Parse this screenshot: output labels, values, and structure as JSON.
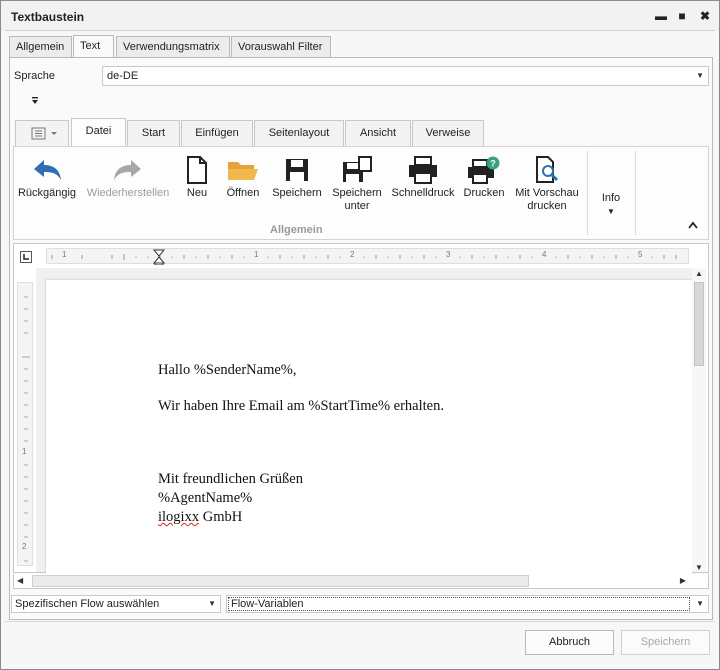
{
  "window": {
    "title": "Textbaustein",
    "controls": [
      "▬",
      "■",
      "✖"
    ]
  },
  "outer_tabs": [
    {
      "label": "Allgemein",
      "active": false
    },
    {
      "label": "Text",
      "active": true
    },
    {
      "label": "Verwendungsmatrix",
      "active": false
    },
    {
      "label": "Vorauswahl Filter",
      "active": false
    }
  ],
  "language": {
    "label": "Sprache",
    "value": "de-DE"
  },
  "ribbon": {
    "tabs": [
      "Datei",
      "Start",
      "Einfügen",
      "Seitenlayout",
      "Ansicht",
      "Verweise"
    ],
    "active_tab": "Datei",
    "buttons": {
      "undo": "Rückgängig",
      "redo": "Wiederherstellen",
      "new": "Neu",
      "open": "Öffnen",
      "save": "Speichern",
      "save_as_1": "Speichern",
      "save_as_2": "unter",
      "quick_print": "Schnelldruck",
      "print": "Drucken",
      "print_preview_1": "Mit Vorschau",
      "print_preview_2": "drucken",
      "info": "Info"
    },
    "group_label": "Allgemein"
  },
  "ruler": {
    "numbers": [
      "1",
      "1",
      "2",
      "3",
      "4",
      "5"
    ],
    "vnumbers": [
      "1",
      "2"
    ]
  },
  "document": {
    "lines": [
      "Hallo %SenderName%,",
      "Wir haben Ihre Email am %StartTime% erhalten.",
      "Mit freundlichen Grüßen",
      "%AgentName%",
      "ilogixx GmbH"
    ],
    "misspelled_word": "ilogixx",
    "after_misspelled": " GmbH"
  },
  "flow_select": {
    "value": "Spezifischen Flow auswählen"
  },
  "vars_select": {
    "value": "Flow-Variablen"
  },
  "footer": {
    "cancel": "Abbruch",
    "save": "Speichern"
  },
  "colors": {
    "undo_arrow": "#2f6fb3",
    "open_folder": "#f0b84e",
    "help_badge": "#3aa27a",
    "redo_disabled": "#a7a7a7"
  }
}
